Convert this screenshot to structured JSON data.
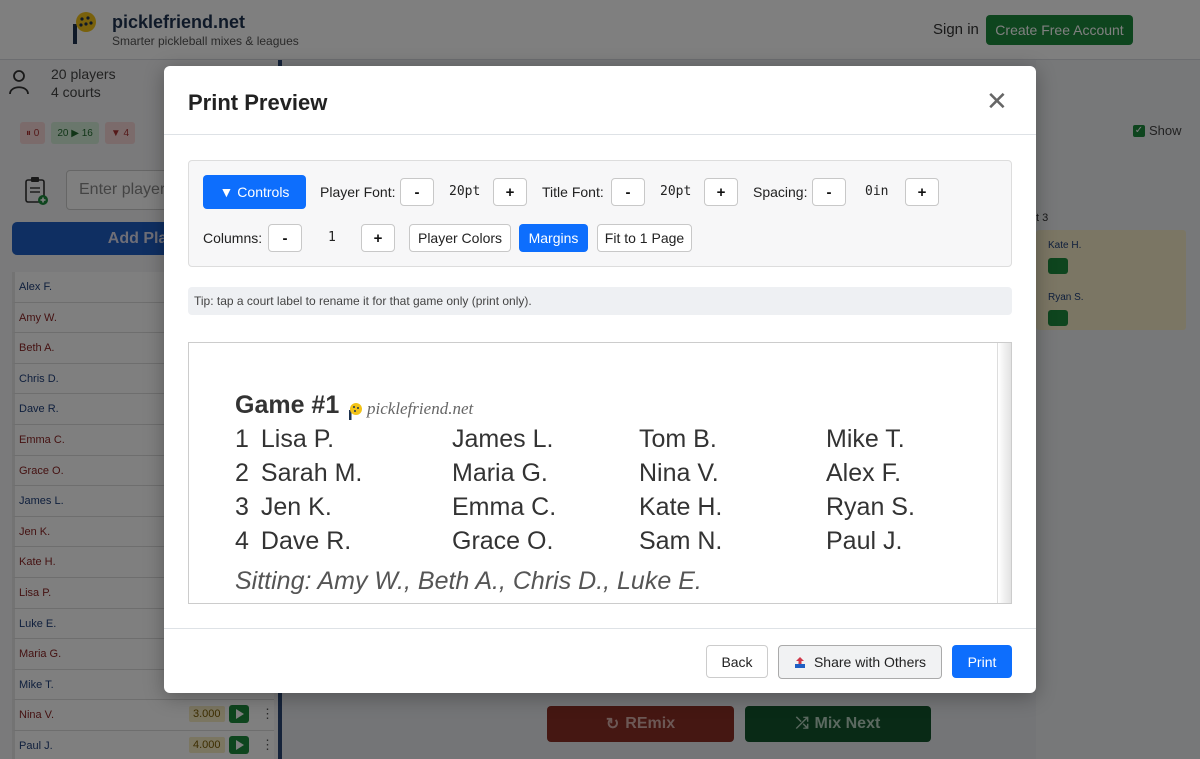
{
  "brand": {
    "name": "picklefriend.net",
    "tagline": "Smarter pickleball mixes & leagues"
  },
  "header": {
    "signin": "Sign in",
    "create_account": "Create Free Account"
  },
  "left": {
    "stat_players": "20 players",
    "stat_courts": "4 courts",
    "chip_paused": "⏸ 0",
    "chip_move": "20 ▶ 16",
    "chip_down": "▼ 4",
    "input_placeholder": "Enter player",
    "add_button": "Add Play",
    "players": [
      {
        "name": "Alex F.",
        "g": "m"
      },
      {
        "name": "Amy W.",
        "g": "f"
      },
      {
        "name": "Beth A.",
        "g": "f"
      },
      {
        "name": "Chris D.",
        "g": "m"
      },
      {
        "name": "Dave R.",
        "g": "m"
      },
      {
        "name": "Emma C.",
        "g": "f"
      },
      {
        "name": "Grace O.",
        "g": "f"
      },
      {
        "name": "James L.",
        "g": "m"
      },
      {
        "name": "Jen K.",
        "g": "f"
      },
      {
        "name": "Kate H.",
        "g": "f"
      },
      {
        "name": "Lisa P.",
        "g": "f"
      },
      {
        "name": "Luke E.",
        "g": "m"
      },
      {
        "name": "Maria G.",
        "g": "f"
      },
      {
        "name": "Mike T.",
        "g": "m"
      },
      {
        "name": "Nina V.",
        "g": "f",
        "rating": "3.000"
      },
      {
        "name": "Paul J.",
        "g": "m",
        "rating": "4.000"
      }
    ]
  },
  "right": {
    "show_label": "Show",
    "court_label": "t 3",
    "players": [
      "Kate H.",
      "Ryan S."
    ]
  },
  "bottom": {
    "remix": "REmix",
    "mix_next": "Mix Next"
  },
  "modal": {
    "title": "Print Preview",
    "controls_toggle": "▼ Controls",
    "player_font_label": "Player Font:",
    "player_font_value": "20pt",
    "title_font_label": "Title Font:",
    "title_font_value": "20pt",
    "spacing_label": "Spacing:",
    "spacing_value": "0in",
    "columns_label": "Columns:",
    "columns_value": "1",
    "minus": "-",
    "plus": "+",
    "player_colors": "Player Colors",
    "margins": "Margins",
    "fit_page": "Fit to 1 Page",
    "tip": "Tip: tap a court label to rename it for that game only (print only).",
    "preview": {
      "game_title": "Game #1",
      "site": "picklefriend.net",
      "courts": [
        {
          "num": "1",
          "p": [
            "Lisa P.",
            "James L.",
            "Tom B.",
            "Mike T."
          ]
        },
        {
          "num": "2",
          "p": [
            "Sarah M.",
            "Maria G.",
            "Nina V.",
            "Alex F."
          ]
        },
        {
          "num": "3",
          "p": [
            "Jen K.",
            "Emma C.",
            "Kate H.",
            "Ryan S."
          ]
        },
        {
          "num": "4",
          "p": [
            "Dave R.",
            "Grace O.",
            "Sam N.",
            "Paul J."
          ]
        }
      ],
      "sitting": "Sitting: Amy W., Beth A., Chris D., Luke E."
    },
    "back": "Back",
    "share": "Share with Others",
    "print": "Print"
  }
}
